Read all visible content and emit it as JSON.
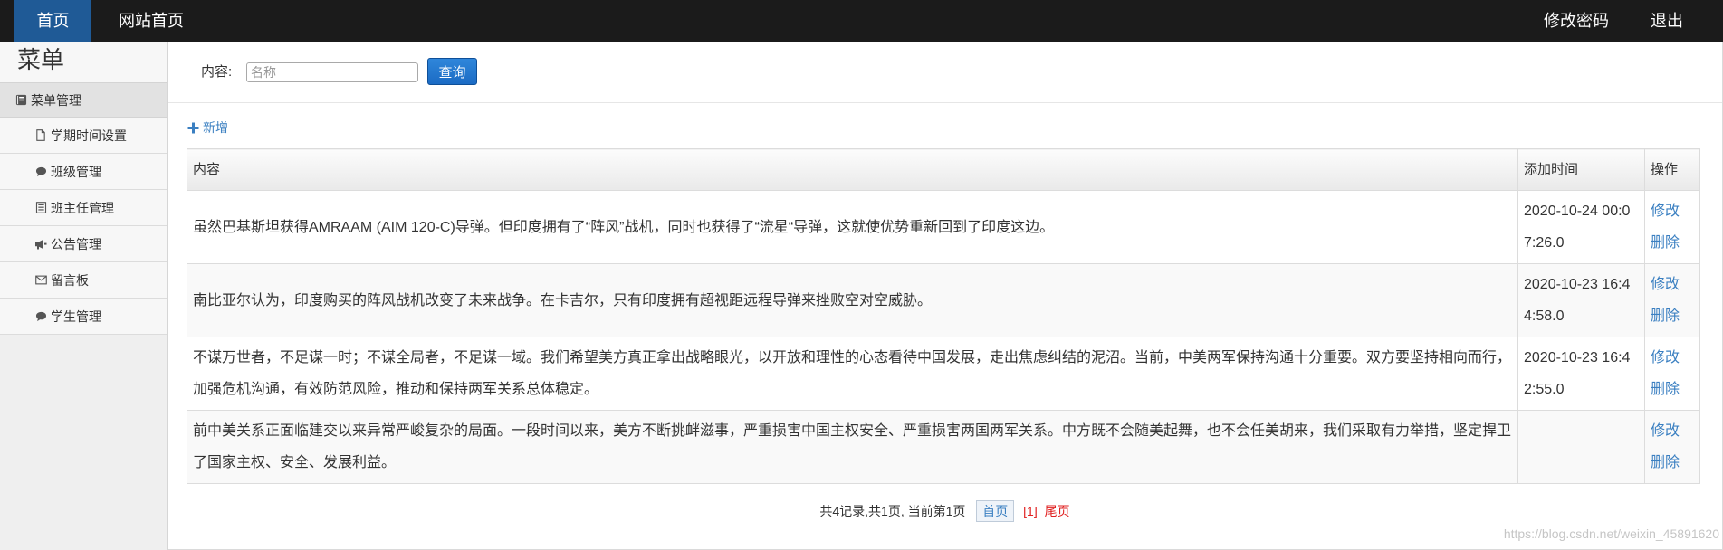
{
  "topbar": {
    "home_tab": "首页",
    "site_home": "网站首页",
    "change_password": "修改密码",
    "logout": "退出"
  },
  "sidebar": {
    "title": "菜单",
    "group": {
      "label": "菜单管理",
      "icon": "book-icon"
    },
    "items": [
      {
        "label": "学期时间设置",
        "icon": "file-icon"
      },
      {
        "label": "班级管理",
        "icon": "comment-icon"
      },
      {
        "label": "班主任管理",
        "icon": "list-alt-icon"
      },
      {
        "label": "公告管理",
        "icon": "bullhorn-icon"
      },
      {
        "label": "留言板",
        "icon": "envelope-icon"
      },
      {
        "label": "学生管理",
        "icon": "comment-icon"
      }
    ]
  },
  "search": {
    "label": "内容:",
    "value": "",
    "placeholder": "名称",
    "button_label": "查询"
  },
  "toolbar": {
    "add_label": "新增",
    "add_icon": "plus-icon"
  },
  "table": {
    "columns": [
      "内容",
      "添加时间",
      "操作"
    ],
    "rows": [
      {
        "content": "虽然巴基斯坦获得AMRAAM (AIM 120-C)导弹。但印度拥有了“阵风”战机，同时也获得了“流星“导弹，这就使优势重新回到了印度这边。",
        "added_time": "2020-10-24 00:07:26.0",
        "actions": [
          "修改",
          "删除"
        ]
      },
      {
        "content": "南比亚尔认为，印度购买的阵风战机改变了未来战争。在卡吉尔，只有印度拥有超视距远程导弹来挫败空对空威胁。",
        "added_time": "2020-10-23 16:44:58.0",
        "actions": [
          "修改",
          "删除"
        ]
      },
      {
        "content": "不谋万世者，不足谋一时；不谋全局者，不足谋一域。我们希望美方真正拿出战略眼光，以开放和理性的心态看待中国发展，走出焦虑纠结的泥沼。当前，中美两军保持沟通十分重要。双方要坚持相向而行，加强危机沟通，有效防范风险，推动和保持两军关系总体稳定。",
        "added_time": "2020-10-23 16:42:55.0",
        "actions": [
          "修改",
          "删除"
        ]
      },
      {
        "content": "前中美关系正面临建交以来异常严峻复杂的局面。一段时间以来，美方不断挑衅滋事，严重损害中国主权安全、严重损害两国两军关系。中方既不会随美起舞，也不会任美胡来，我们采取有力举措，坚定捍卫了国家主权、安全、发展利益。",
        "added_time": "",
        "actions": [
          "修改",
          "删除"
        ]
      }
    ]
  },
  "pagination": {
    "summary": "共4记录,共1页, 当前第1页",
    "first_label": "首页",
    "current_page": "[1]",
    "last_label": "尾页"
  },
  "watermark": "https://blog.csdn.net/weixin_45891620",
  "colors": {
    "topbar_bg": "#1b1b1b",
    "active_tab_bg": "#1f5a96",
    "link": "#3a7fc1",
    "primary_button": "#1b6bc4",
    "pagination_current": "#e02020"
  }
}
